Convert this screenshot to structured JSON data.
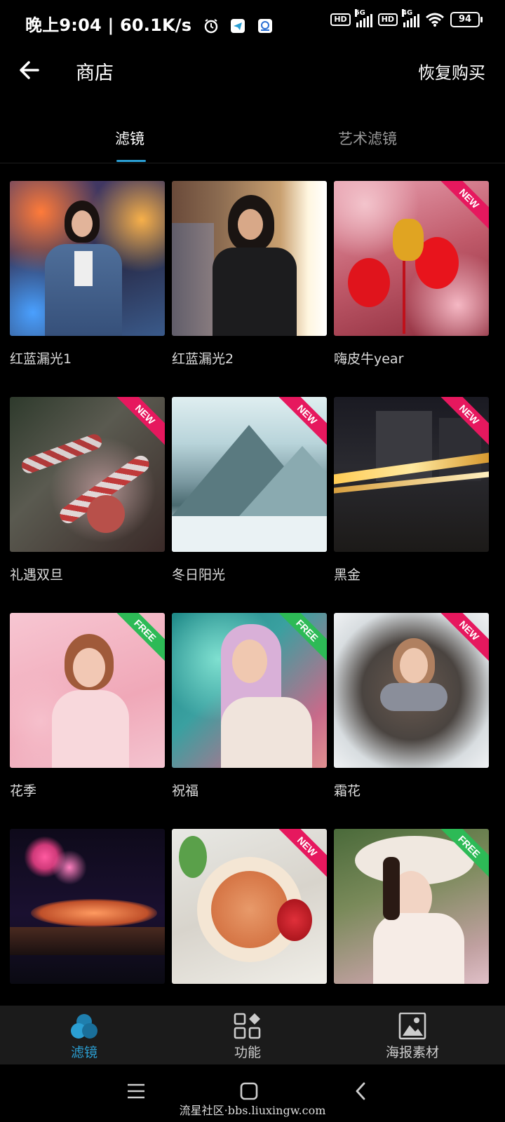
{
  "status_bar": {
    "time": "晚上9:04 | 60.1K/s",
    "hd1": "HD",
    "net1": "5G",
    "hd2": "HD",
    "net2": "4G",
    "battery": "94"
  },
  "header": {
    "title": "商店",
    "restore_label": "恢复购买"
  },
  "tabs": [
    {
      "label": "滤镜",
      "active": true
    },
    {
      "label": "艺术滤镜",
      "active": false
    }
  ],
  "items": [
    {
      "name": "红蓝漏光1",
      "badge": ""
    },
    {
      "name": "红蓝漏光2",
      "badge": ""
    },
    {
      "name": "嗨皮牛year",
      "badge": "NEW"
    },
    {
      "name": "礼遇双旦",
      "badge": "NEW"
    },
    {
      "name": "冬日阳光",
      "badge": "NEW"
    },
    {
      "name": "黑金",
      "badge": "NEW"
    },
    {
      "name": "花季",
      "badge": "FREE"
    },
    {
      "name": "祝福",
      "badge": "FREE"
    },
    {
      "name": "霜花",
      "badge": "NEW"
    },
    {
      "name": "",
      "badge": ""
    },
    {
      "name": "",
      "badge": "NEW"
    },
    {
      "name": "",
      "badge": "FREE"
    }
  ],
  "bottom_nav": [
    {
      "label": "滤镜",
      "icon": "filter-icon",
      "active": true
    },
    {
      "label": "功能",
      "icon": "grid-icon",
      "active": false
    },
    {
      "label": "海报素材",
      "icon": "poster-icon",
      "active": false
    }
  ],
  "watermark": "流星社区·bbs.liuxingw.com",
  "colors": {
    "accent": "#2b9fd3",
    "new_badge": "#e6185e",
    "free_badge": "#2dba56",
    "background": "#000000"
  }
}
